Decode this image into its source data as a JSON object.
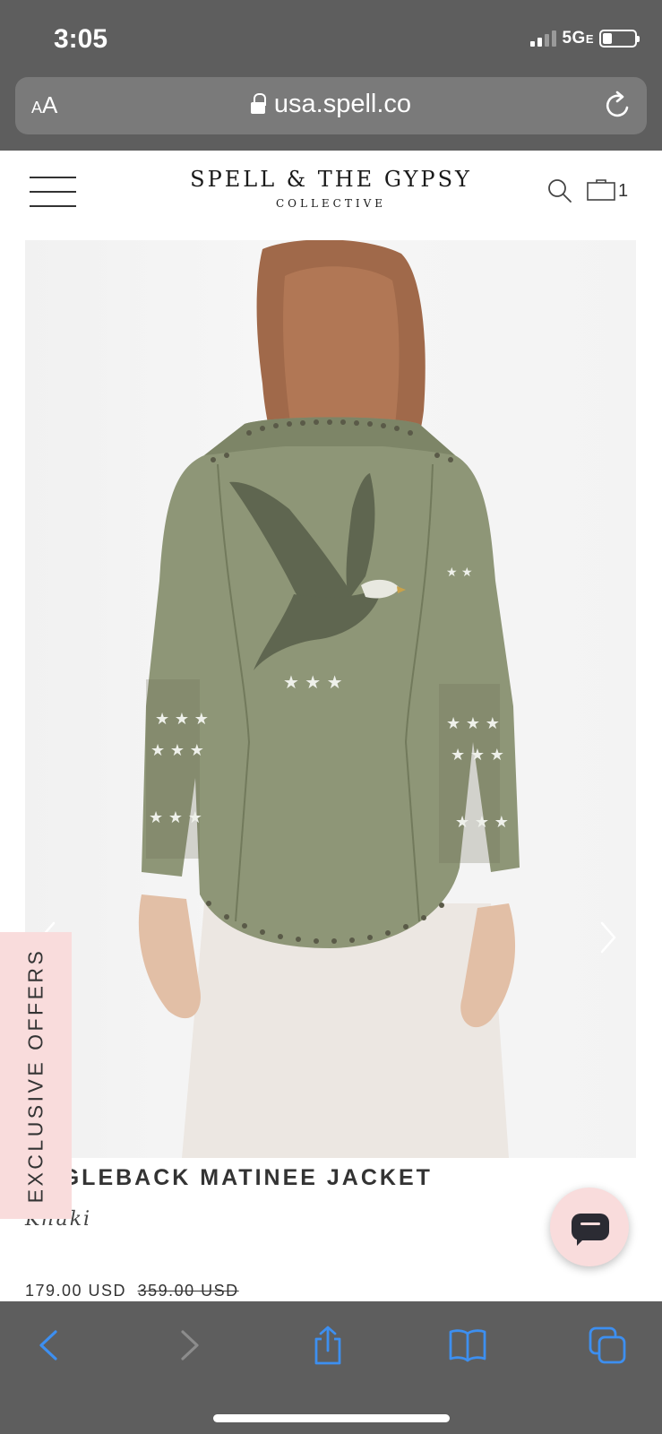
{
  "status_bar": {
    "time": "3:05",
    "network": "5G",
    "network_suffix": "E",
    "battery_level": 0.3
  },
  "browser": {
    "text_size_label_small": "A",
    "text_size_label_large": "A",
    "url": "usa.spell.co"
  },
  "header": {
    "logo_main": "SPELL & THE GYPSY",
    "logo_sub": "COLLECTIVE",
    "cart_count": "1"
  },
  "product": {
    "title": "EAGLEBACK MATINEE JACKET",
    "color": "Khaki",
    "price": "179.00 USD",
    "original_price": "359.00 USD"
  },
  "offers_tab": {
    "label": "EXCLUSIVE OFFERS"
  },
  "colors": {
    "chrome": "#5e5e5e",
    "accent_pink": "#f9dcdc",
    "safari_blue": "#3d8ff0",
    "jacket_khaki": "#8e9677"
  }
}
